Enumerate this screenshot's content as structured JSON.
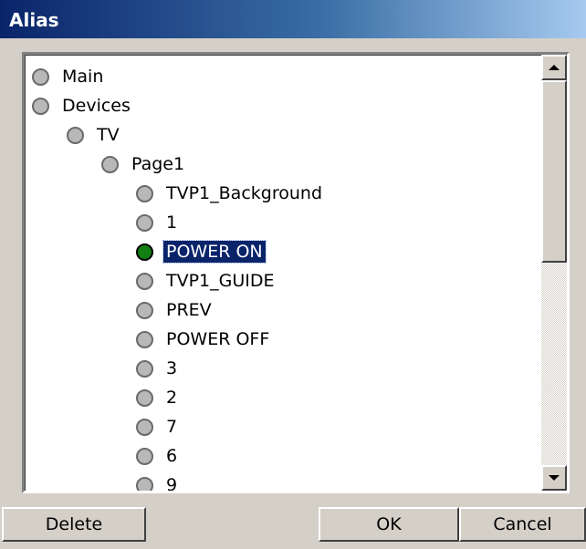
{
  "window": {
    "title": "Alias"
  },
  "tree": {
    "items": [
      {
        "label": "Main",
        "level": 0
      },
      {
        "label": "Devices",
        "level": 0
      },
      {
        "label": "TV",
        "level": 1
      },
      {
        "label": "Page1",
        "level": 2
      },
      {
        "label": "TVP1_Background",
        "level": 3
      },
      {
        "label": "1",
        "level": 3
      },
      {
        "label": "POWER ON",
        "level": 3,
        "selected": true,
        "active": true
      },
      {
        "label": "TVP1_GUIDE",
        "level": 3
      },
      {
        "label": "PREV",
        "level": 3
      },
      {
        "label": "POWER OFF",
        "level": 3
      },
      {
        "label": "3",
        "level": 3
      },
      {
        "label": "2",
        "level": 3
      },
      {
        "label": "7",
        "level": 3
      },
      {
        "label": "6",
        "level": 3
      },
      {
        "label": "9",
        "level": 3
      }
    ]
  },
  "buttons": {
    "delete": "Delete",
    "ok": "OK",
    "cancel": "Cancel"
  },
  "colors": {
    "active_node": "#128012",
    "selection": "#0a246a",
    "titlebar": "#0a246a"
  },
  "icons": {
    "node": "circle-node-icon",
    "scroll_up": "arrow-up-icon",
    "scroll_down": "arrow-down-icon"
  }
}
